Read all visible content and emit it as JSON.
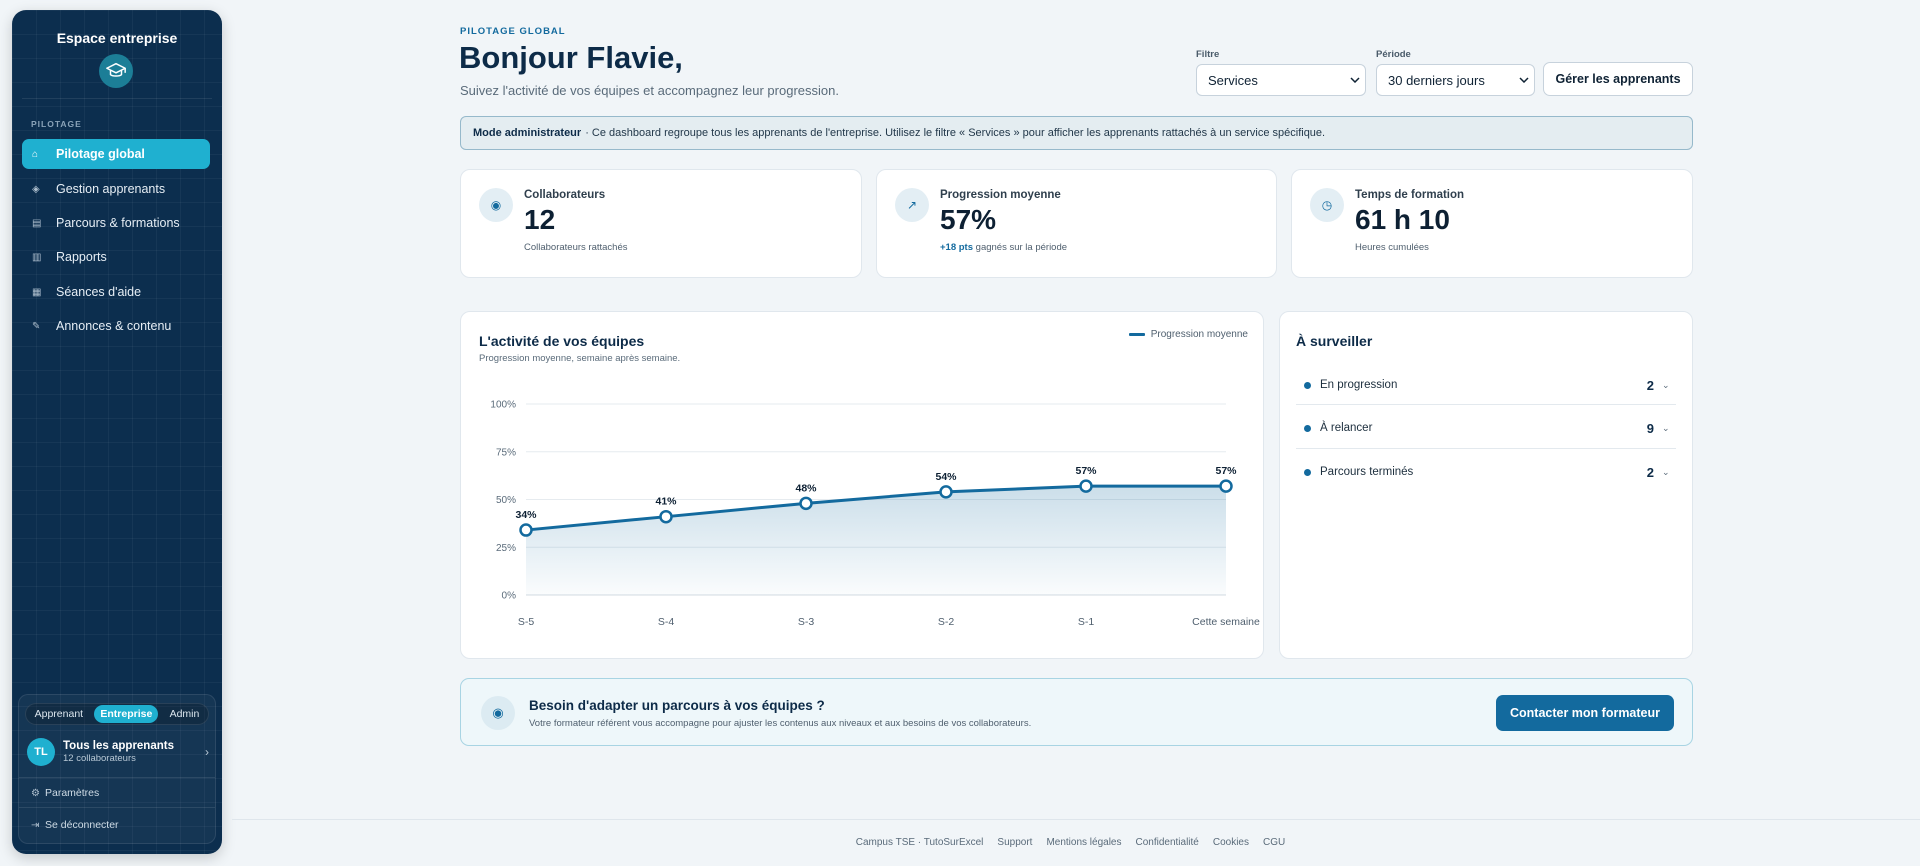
{
  "sidebar": {
    "title": "Espace entreprise",
    "section": "PILOTAGE",
    "items": [
      {
        "label": "Pilotage global",
        "icon": "home-icon",
        "glyph": "⌂",
        "active": true
      },
      {
        "label": "Gestion apprenants",
        "icon": "users-icon",
        "glyph": "◈",
        "active": false
      },
      {
        "label": "Parcours & formations",
        "icon": "book-icon",
        "glyph": "▤",
        "active": false
      },
      {
        "label": "Rapports",
        "icon": "report-icon",
        "glyph": "▥",
        "active": false
      },
      {
        "label": "Séances d'aide",
        "icon": "calendar-icon",
        "glyph": "▦",
        "active": false
      },
      {
        "label": "Annonces & contenu",
        "icon": "pen-icon",
        "glyph": "✎",
        "active": false
      }
    ],
    "roles": [
      "Apprenant",
      "Entreprise",
      "Admin"
    ],
    "active_role": "Entreprise",
    "user": {
      "initials": "TL",
      "name": "Tous les apprenants",
      "sub": "12 collaborateurs"
    },
    "settings": "Paramètres",
    "logout": "Se déconnecter"
  },
  "header": {
    "overline": "PILOTAGE GLOBAL",
    "title": "Bonjour Flavie,",
    "subtitle": "Suivez l'activité de vos équipes et accompagnez leur progression.",
    "filter_label": "Filtre",
    "filter_value": "Services",
    "period_label": "Période",
    "period_value": "30 derniers jours",
    "manage_button": "Gérer les apprenants"
  },
  "banner": {
    "bold": "Mode administrateur",
    "text": "· Ce dashboard regroupe tous les apprenants de l'entreprise. Utilisez le filtre « Services » pour afficher les apprenants rattachés à un service spécifique."
  },
  "kpis": [
    {
      "label": "Collaborateurs",
      "value": "12",
      "note_prefix": "",
      "note": "Collaborateurs rattachés",
      "icon": "eye-icon",
      "glyph": "◉"
    },
    {
      "label": "Progression moyenne",
      "value": "57%",
      "note_prefix": "+18 pts",
      "note": "gagnés sur la période",
      "icon": "trend-up-icon",
      "glyph": "↗"
    },
    {
      "label": "Temps de formation",
      "value": "61 h 10",
      "note_prefix": "",
      "note": "Heures cumulées",
      "icon": "clock-icon",
      "glyph": "◷"
    }
  ],
  "activity": {
    "title": "L'activité de vos équipes",
    "subtitle": "Progression moyenne, semaine après semaine.",
    "legend": "Progression moyenne"
  },
  "chart_data": {
    "type": "area",
    "title": "L'activité de vos équipes",
    "subtitle": "Progression moyenne, semaine après semaine.",
    "categories": [
      "S-5",
      "S-4",
      "S-3",
      "S-2",
      "S-1",
      "Cette semaine"
    ],
    "series": [
      {
        "name": "Progression moyenne",
        "values": [
          34,
          41,
          48,
          54,
          57,
          57
        ]
      }
    ],
    "data_labels": [
      "34%",
      "41%",
      "48%",
      "54%",
      "57%",
      "57%"
    ],
    "y_ticks": [
      "0%",
      "25%",
      "50%",
      "75%",
      "100%"
    ],
    "ylim": [
      0,
      100
    ],
    "grid": true,
    "legend_position": "top-right",
    "color": "#136a9e"
  },
  "watch": {
    "title": "À surveiller",
    "rows": [
      {
        "label": "En progression",
        "count": "2"
      },
      {
        "label": "À relancer",
        "count": "9"
      },
      {
        "label": "Parcours terminés",
        "count": "2"
      }
    ]
  },
  "help": {
    "title": "Besoin d'adapter un parcours à vos équipes ?",
    "text": "Votre formateur référent vous accompagne pour ajuster les contenus aux niveaux et aux besoins de vos collaborateurs.",
    "button": "Contacter mon formateur"
  },
  "footer": {
    "links": [
      "Campus TSE · TutoSurExcel",
      "Support",
      "Mentions légales",
      "Confidentialité",
      "Cookies",
      "CGU"
    ]
  }
}
